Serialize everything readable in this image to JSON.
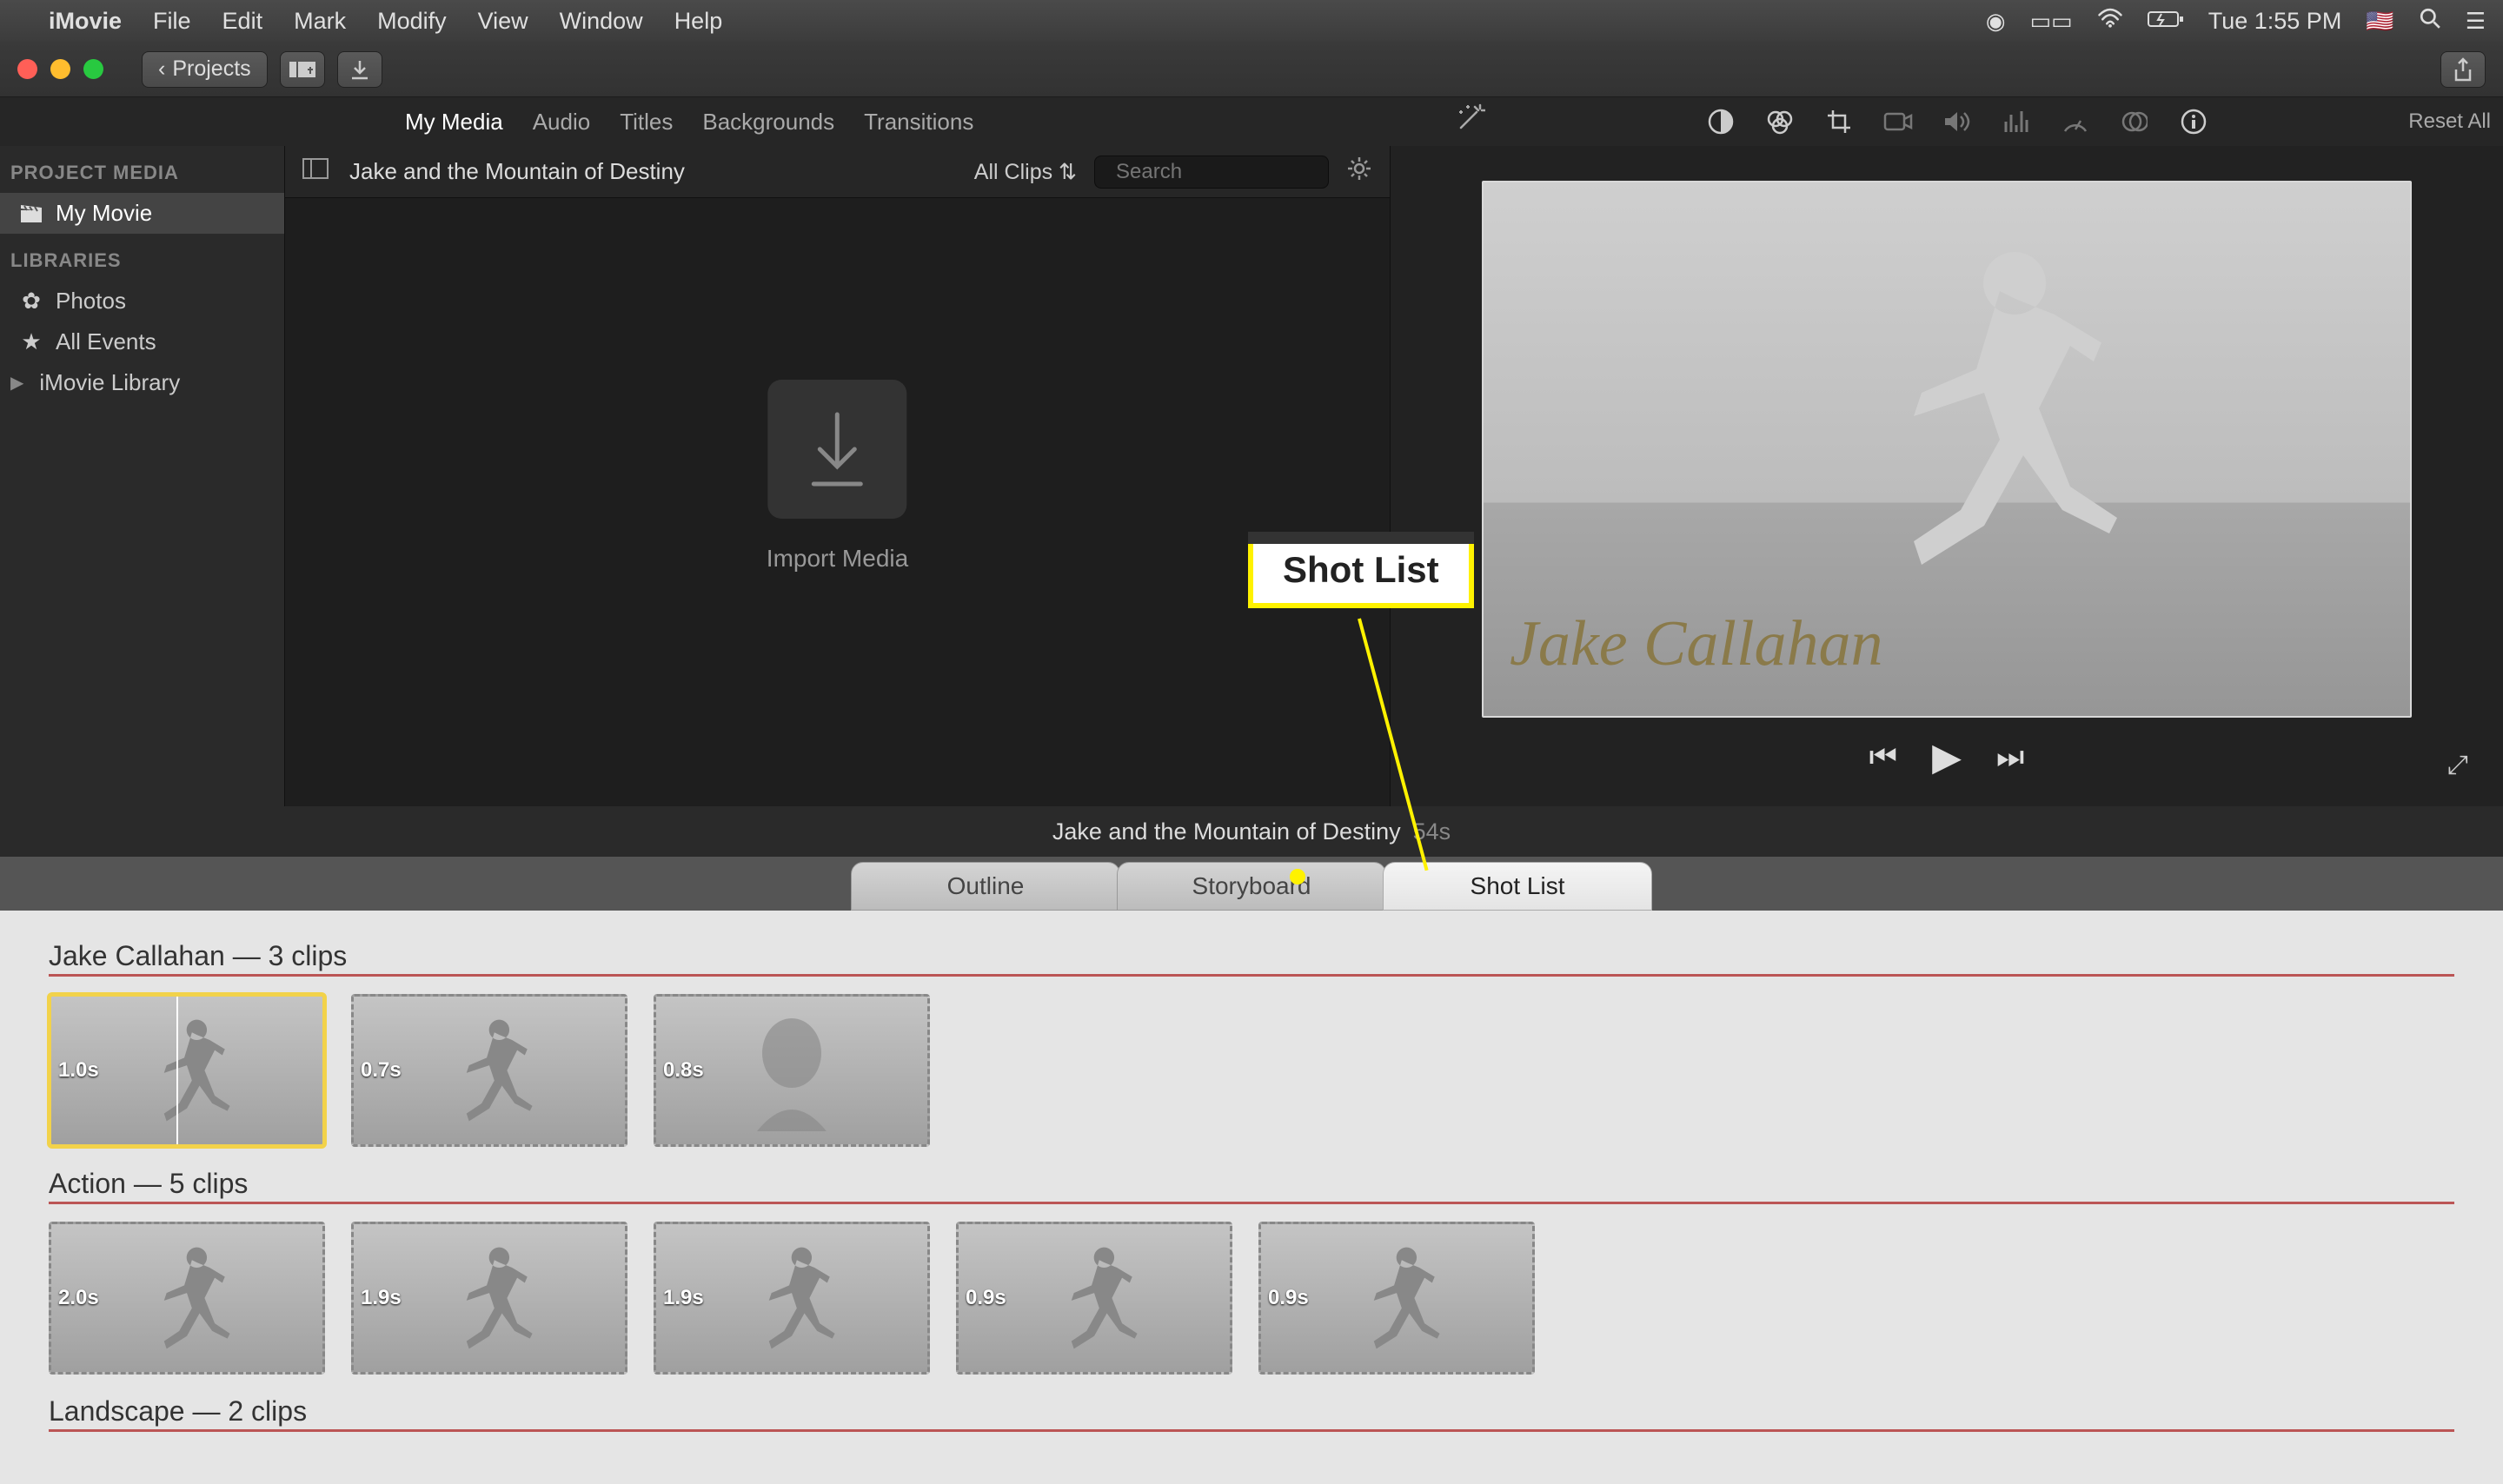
{
  "menubar": {
    "app": "iMovie",
    "items": [
      "File",
      "Edit",
      "Mark",
      "Modify",
      "View",
      "Window",
      "Help"
    ],
    "clock": "Tue 1:55 PM"
  },
  "toolbar": {
    "projects_label": "Projects"
  },
  "media_tabs": [
    "My Media",
    "Audio",
    "Titles",
    "Backgrounds",
    "Transitions"
  ],
  "reset_all": "Reset All",
  "sidebar": {
    "heading_project": "PROJECT MEDIA",
    "my_movie": "My Movie",
    "heading_libs": "LIBRARIES",
    "photos": "Photos",
    "all_events": "All Events",
    "library": "iMovie Library"
  },
  "browser": {
    "title": "Jake and the Mountain of Destiny",
    "clips_dropdown": "All Clips",
    "search_placeholder": "Search",
    "import_label": "Import Media"
  },
  "preview": {
    "title_card": "Jake Callahan"
  },
  "timeline": {
    "title": "Jake and the Mountain of Destiny",
    "duration": "54s"
  },
  "callout": {
    "label": "Shot List"
  },
  "seg_tabs": {
    "outline": "Outline",
    "storyboard": "Storyboard",
    "shotlist": "Shot List"
  },
  "shotlist": {
    "sections": [
      {
        "title": "Jake Callahan — 3 clips",
        "clips": [
          {
            "dur": "1.0s",
            "kind": "run",
            "selected": true
          },
          {
            "dur": "0.7s",
            "kind": "run"
          },
          {
            "dur": "0.8s",
            "kind": "head"
          }
        ]
      },
      {
        "title": "Action — 5 clips",
        "clips": [
          {
            "dur": "2.0s",
            "kind": "run"
          },
          {
            "dur": "1.9s",
            "kind": "run"
          },
          {
            "dur": "1.9s",
            "kind": "run"
          },
          {
            "dur": "0.9s",
            "kind": "run"
          },
          {
            "dur": "0.9s",
            "kind": "run"
          }
        ]
      },
      {
        "title": "Landscape — 2 clips",
        "clips": []
      }
    ]
  }
}
